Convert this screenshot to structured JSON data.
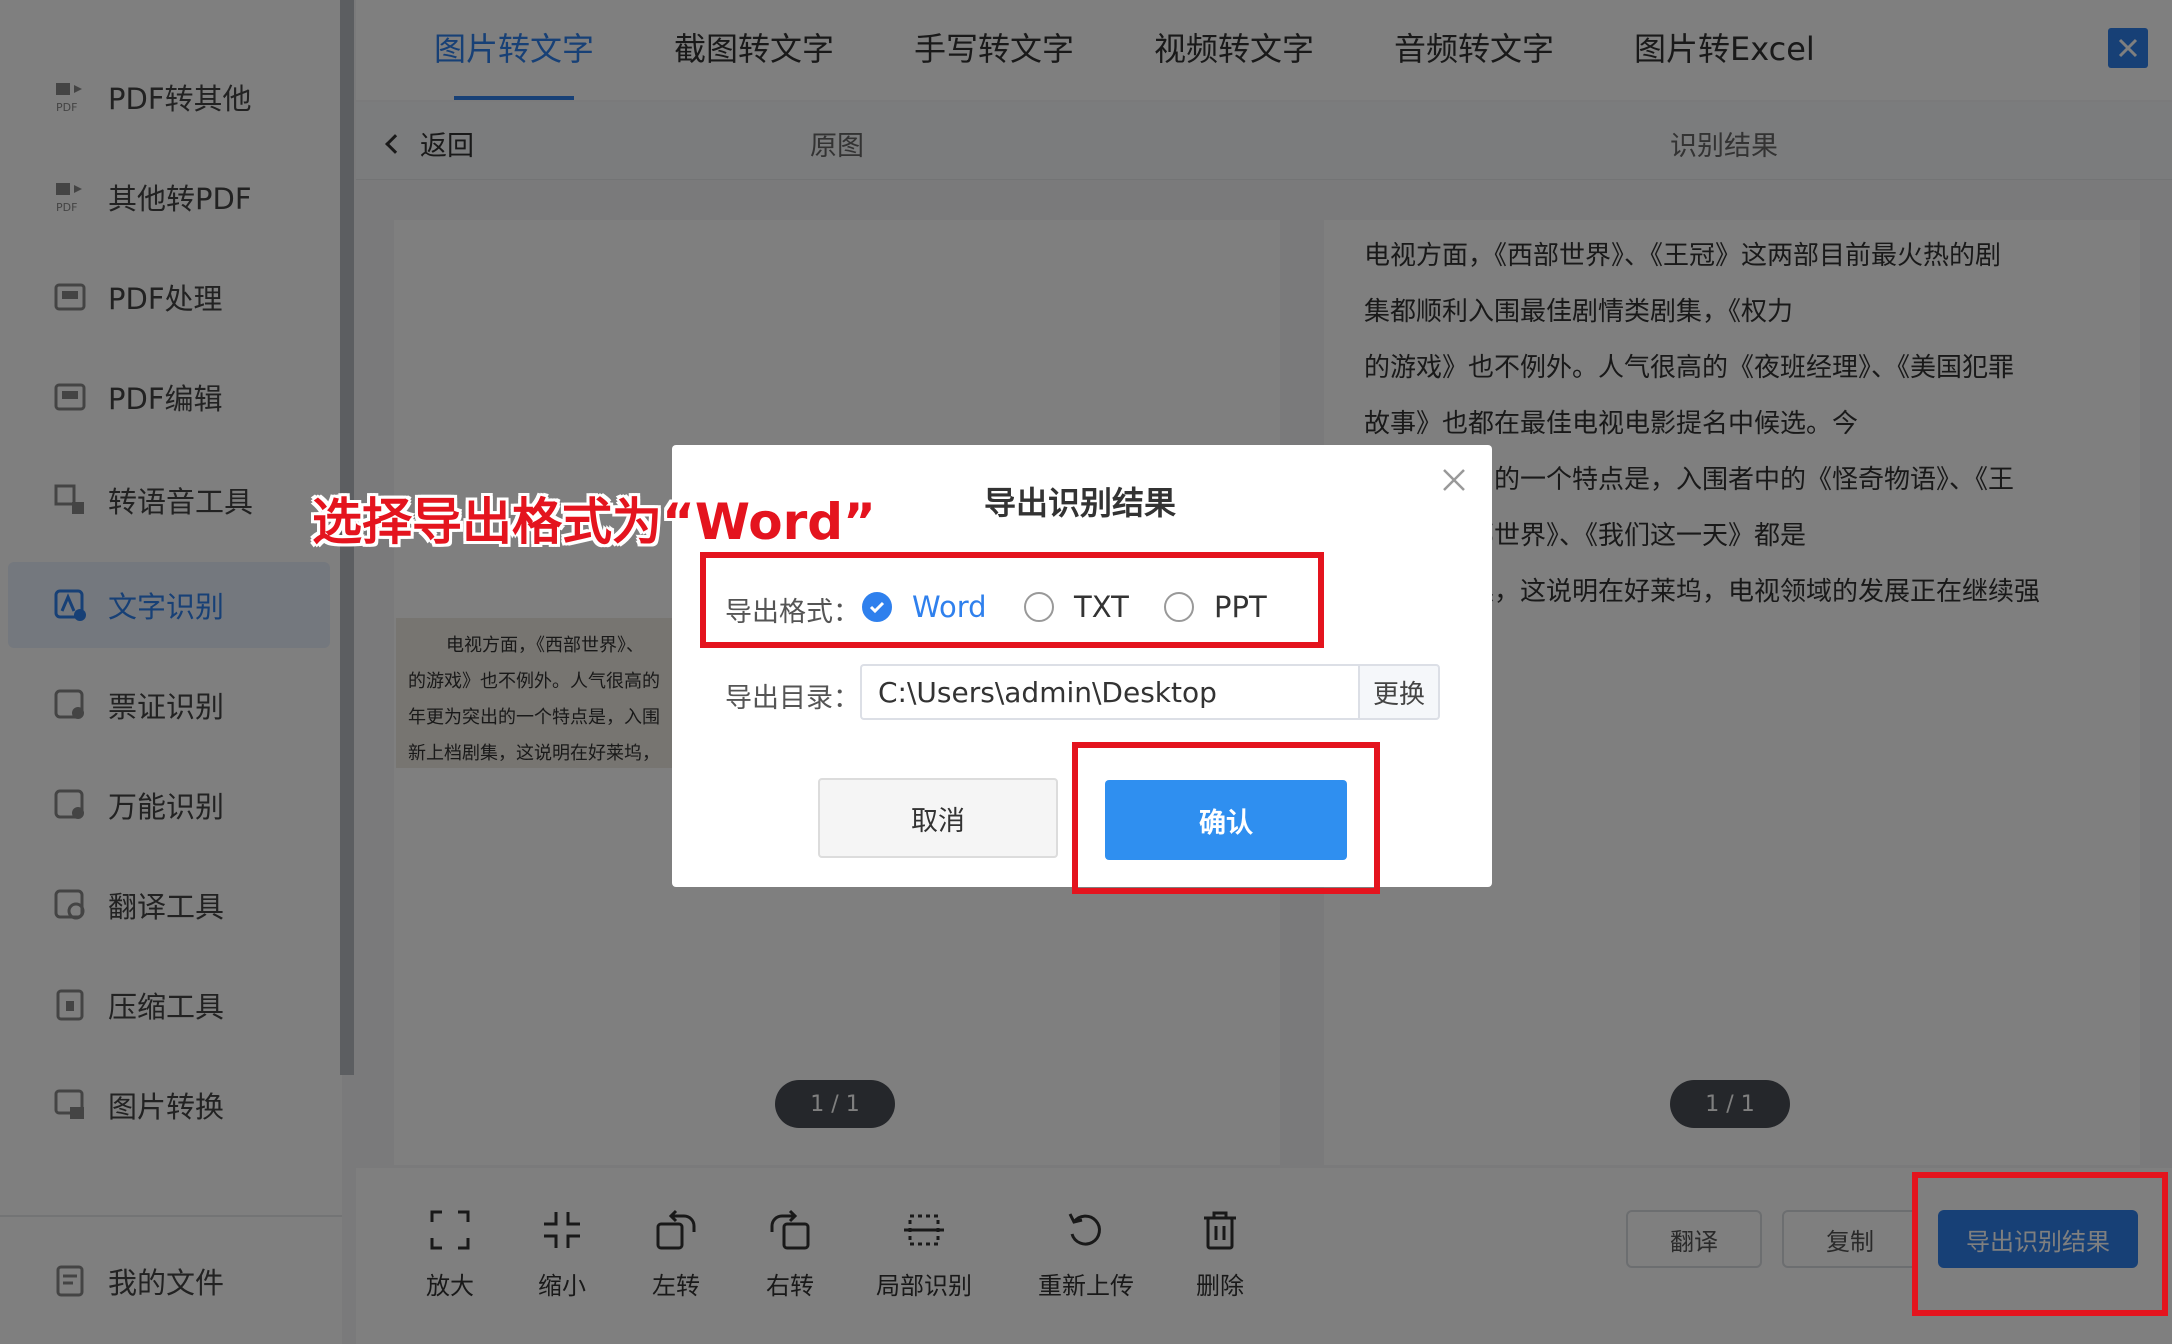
{
  "sidebar": {
    "items": [
      {
        "label": "PDF转其他",
        "icon": "pdf-convert-icon"
      },
      {
        "label": "其他转PDF",
        "icon": "to-pdf-icon"
      },
      {
        "label": "PDF处理",
        "icon": "pdf-process-icon"
      },
      {
        "label": "PDF编辑",
        "icon": "pdf-edit-icon"
      },
      {
        "label": "转语音工具",
        "icon": "text-to-speech-icon"
      },
      {
        "label": "文字识别",
        "icon": "ocr-icon",
        "active": true
      },
      {
        "label": "票证识别",
        "icon": "ticket-icon"
      },
      {
        "label": "万能识别",
        "icon": "universal-scan-icon"
      },
      {
        "label": "翻译工具",
        "icon": "translate-icon"
      },
      {
        "label": "压缩工具",
        "icon": "compress-icon"
      },
      {
        "label": "图片转换",
        "icon": "image-convert-icon"
      },
      {
        "label": "我的文件",
        "icon": "my-files-icon"
      }
    ]
  },
  "tabs": [
    {
      "label": "图片转文字",
      "active": true
    },
    {
      "label": "截图转文字"
    },
    {
      "label": "手写转文字"
    },
    {
      "label": "视频转文字"
    },
    {
      "label": "音频转文字"
    },
    {
      "label": "图片转Excel"
    }
  ],
  "subheader": {
    "back_label": "返回",
    "original_label": "原图",
    "result_label": "识别结果"
  },
  "original_image": {
    "lines": [
      "电视方面，《西部世界》、",
      "的游戏》也不例外。人气很高的",
      "年更为突出的一个特点是，入围",
      "新上档剧集，这说明在好莱坞，"
    ]
  },
  "result_text": {
    "lines": [
      "电视方面，《西部世界》、《王冠》这两部目前最火热的剧",
      "集都顺利入围最佳剧情类剧集，《权力",
      "的游戏》也不例外。人气很高的《夜班经理》、《美国犯罪",
      "故事》也都在最佳电视电影提名中候选。今",
      "年更为突出的一个特点是，入围者中的《怪奇物语》、《王",
      "冠》、《西部世界》、《我们这一天》都是",
      "新上档剧集，这说明在好莱坞，电视领域的发展正在继续强"
    ]
  },
  "pager": {
    "left": "1 / 1",
    "right": "1 / 1"
  },
  "toolbar": {
    "tools": [
      {
        "label": "放大",
        "icon": "zoom-in-icon"
      },
      {
        "label": "缩小",
        "icon": "zoom-out-icon"
      },
      {
        "label": "左转",
        "icon": "rotate-left-icon"
      },
      {
        "label": "右转",
        "icon": "rotate-right-icon"
      },
      {
        "label": "局部识别",
        "icon": "crop-recognize-icon"
      },
      {
        "label": "重新上传",
        "icon": "reupload-icon"
      },
      {
        "label": "删除",
        "icon": "trash-icon"
      }
    ],
    "translate_label": "翻译",
    "copy_label": "复制",
    "export_label": "导出识别结果"
  },
  "dialog": {
    "title": "导出识别结果",
    "format_label": "导出格式：",
    "formats": [
      {
        "label": "Word",
        "checked": true
      },
      {
        "label": "TXT",
        "checked": false
      },
      {
        "label": "PPT",
        "checked": false
      }
    ],
    "dir_label": "导出目录：",
    "dir_value": "C:\\Users\\admin\\Desktop",
    "change_label": "更换",
    "cancel_label": "取消",
    "confirm_label": "确认"
  },
  "annotation": {
    "callout": "选择导出格式为“Word”",
    "color": "#e4141e"
  },
  "colors": {
    "accent": "#2f80ed",
    "overlay": "rgba(0,0,0,0.5)"
  }
}
